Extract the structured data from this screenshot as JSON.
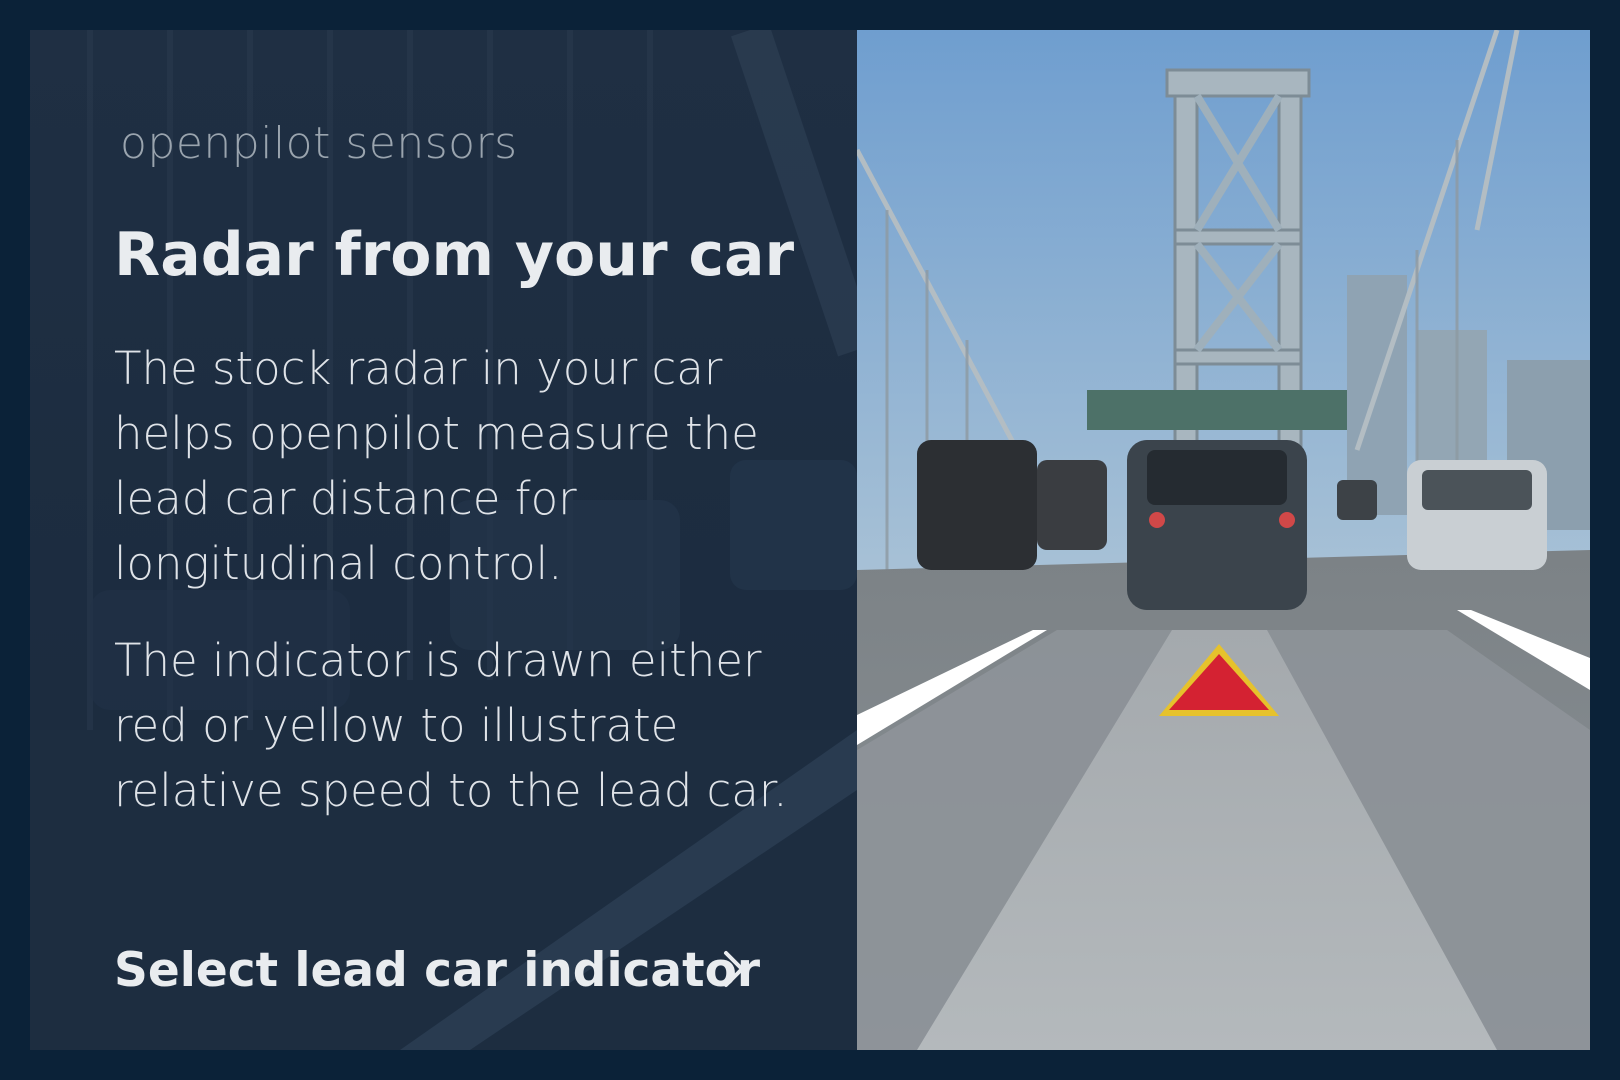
{
  "panel": {
    "subtitle": "openpilot sensors",
    "title": "Radar from your car",
    "paragraphs": [
      "The stock radar in your car helps openpilot measure the lead car distance for longitudinal control.",
      "The indicator is drawn either red or yellow to illustrate relative speed to the lead car."
    ],
    "action_label": "Select lead car indicator",
    "action_icon": "chevron-right-icon"
  },
  "colors": {
    "background": "#0b2238",
    "panel": "#1c2c40",
    "indicator_fill": "#d42232",
    "indicator_border": "#e6c22c"
  }
}
